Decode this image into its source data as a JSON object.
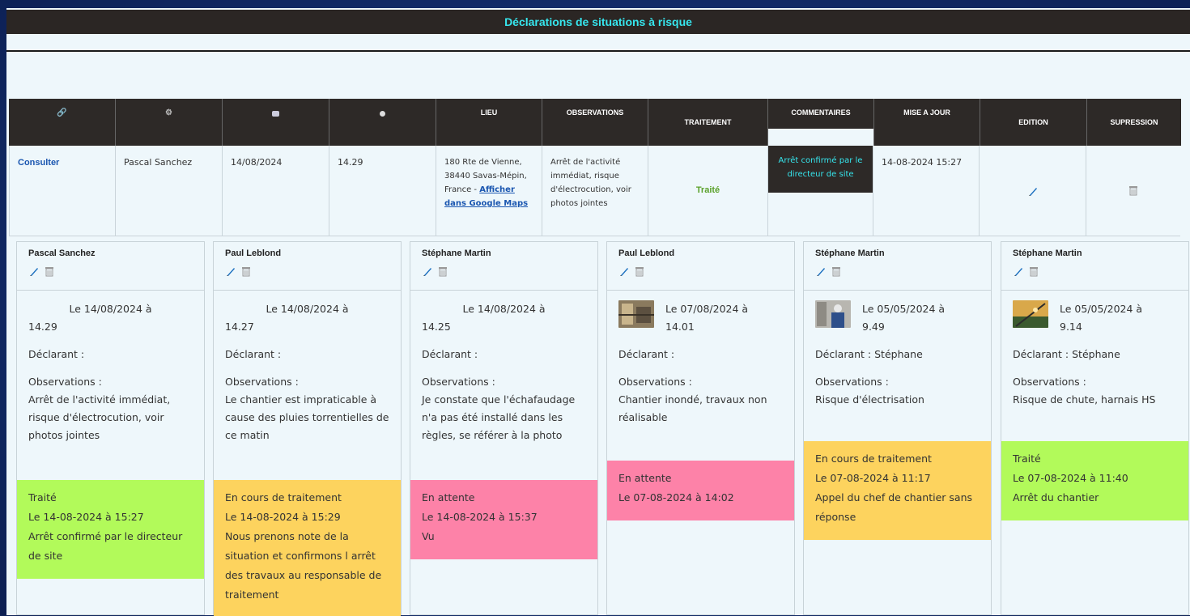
{
  "title": "Déclarations de situations à risque",
  "colors": {
    "title_text": "#36e6ee",
    "header_bg": "#2d2927",
    "traite": "#5aa12a",
    "status_green": "#b2fa5a",
    "status_yellow": "#fdd35e",
    "status_pink": "#fd82a8"
  },
  "table": {
    "headers": {
      "link_icon": "link-icon",
      "user_icon": "user-icon",
      "calendar_icon": "calendar-icon",
      "clock_icon": "clock-icon",
      "lieu": "LIEU",
      "observations": "OBSERVATIONS",
      "traitement": "TRAITEMENT",
      "commentaires": "COMMENTAIRES",
      "mise_a_jour": "MISE A JOUR",
      "edition": "EDITION",
      "supression": "SUPRESSION"
    },
    "row": {
      "consulter": "Consulter",
      "declarant": "Pascal Sanchez",
      "date": "14/08/2024",
      "heure": "14.29",
      "lieu_text": "180 Rte de Vienne, 38440 Savas-Mépin, France - ",
      "lieu_link": "Afficher dans Google Maps",
      "observations": "Arrêt de l'activité immédiat, risque d'électrocution, voir photos jointes",
      "traitement": "Traité",
      "commentaire": "Arrêt confirmé par le directeur de site",
      "mise_a_jour": "14-08-2024 15:27"
    }
  },
  "cards": [
    {
      "name": "Pascal Sanchez",
      "date": "Le 14/08/2024 à",
      "time": "14.29",
      "declarant": "Déclarant :",
      "obs_label": "Observations :",
      "obs": "Arrêt de l'activité immédiat, risque d'électrocution, voir photos jointes",
      "status": "Traité",
      "status_date": "Le 14-08-2024 à 15:27",
      "status_comment": "Arrêt confirmé par le directeur de site"
    },
    {
      "name": "Paul Leblond",
      "date": "Le 14/08/2024 à",
      "time": "14.27",
      "declarant": "Déclarant :",
      "obs_label": "Observations :",
      "obs": "Le chantier est impraticable à cause des pluies torrentielles de ce matin",
      "status": "En cours de traitement",
      "status_date": "Le 14-08-2024 à 15:29",
      "status_comment": "Nous prenons note de la situation et confirmons l arrêt des travaux au responsable de traitement"
    },
    {
      "name": "Stéphane Martin",
      "date": "Le 14/08/2024 à",
      "time": "14.25",
      "declarant": "Déclarant :",
      "obs_label": "Observations :",
      "obs": "Je constate que l'échafaudage n'a pas été installé dans les règles, se référer à la photo",
      "status": "En attente",
      "status_date": "Le 14-08-2024 à 15:37",
      "status_comment": "Vu"
    },
    {
      "name": "Paul Leblond",
      "date": "Le 07/08/2024 à",
      "time": "14.01",
      "declarant": "Déclarant :",
      "obs_label": "Observations :",
      "obs": "Chantier inondé, travaux non réalisable",
      "status": "En attente",
      "status_date": "Le 07-08-2024 à 14:02",
      "status_comment": ""
    },
    {
      "name": "Stéphane Martin",
      "date": "Le 05/05/2024 à",
      "time": "9.49",
      "declarant": "Déclarant : Stéphane",
      "obs_label": "Observations :",
      "obs": "Risque d'électrisation",
      "status": "En cours de traitement",
      "status_date": "Le 07-08-2024 à 11:17",
      "status_comment": "Appel du chef de chantier sans réponse"
    },
    {
      "name": "Stéphane Martin",
      "date": "Le 05/05/2024 à",
      "time": "9.14",
      "declarant": "Déclarant : Stéphane",
      "obs_label": "Observations :",
      "obs": "Risque de chute, harnais HS",
      "status": "Traité",
      "status_date": "Le 07-08-2024 à 11:40",
      "status_comment": "Arrêt du chantier"
    }
  ]
}
